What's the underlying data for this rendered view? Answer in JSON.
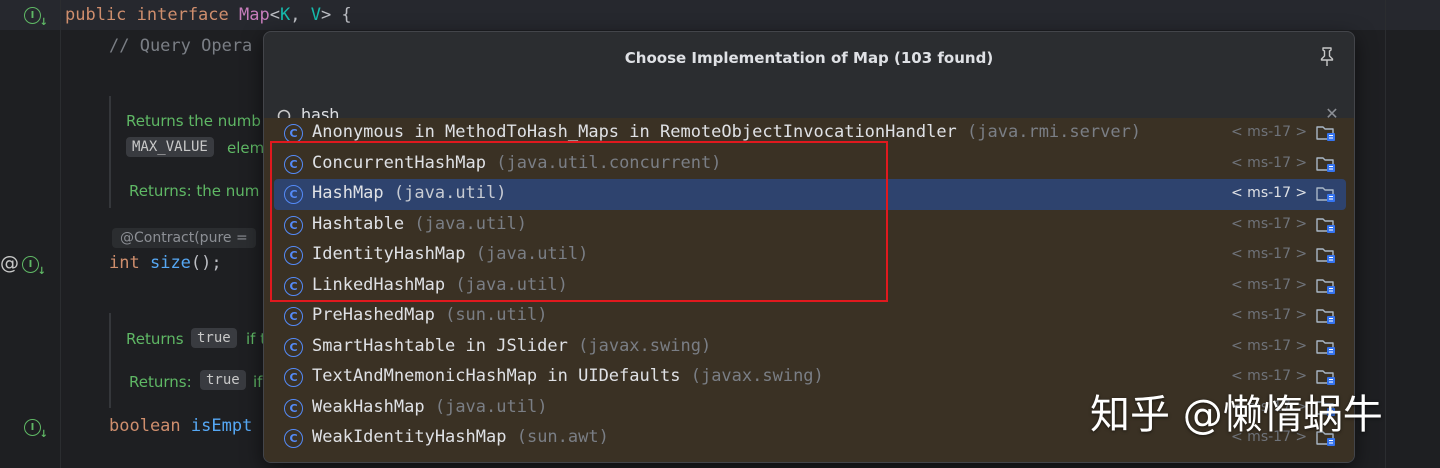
{
  "editor": {
    "line1": {
      "kw": "public interface ",
      "type": "Map",
      "lt": "<",
      "k": "K",
      "comma": ", ",
      "v": "V",
      "gt": "> {"
    },
    "comment": "// Query Opera",
    "doc1": {
      "text1": "Returns the numb",
      "code1": "MAX_VALUE",
      "text2": "elem",
      "returns": "Returns: the num"
    },
    "inlay_contract": "@Contract(pure =",
    "size_line": {
      "kw": "int",
      "fn": "size",
      "rest": "();"
    },
    "doc2": {
      "returns1": "Returns",
      "code1": "true",
      "tail1": "if t",
      "returns2": "Returns:",
      "code2": "true",
      "tail2": "if"
    },
    "isempty_line": {
      "kw": "boolean",
      "fn": "isEmpt"
    }
  },
  "popup": {
    "title": "Choose Implementation of Map (103 found)",
    "search_value": "hash",
    "items": [
      {
        "name": "Anonymous in MethodToHash_Maps in RemoteObjectInvocationHandler",
        "pkg": "(java.rmi.server)",
        "module": "< ms-17 >"
      },
      {
        "name": "ConcurrentHashMap",
        "pkg": "(java.util.concurrent)",
        "module": "< ms-17 >"
      },
      {
        "name": "HashMap",
        "pkg": "(java.util)",
        "module": "< ms-17 >"
      },
      {
        "name": "Hashtable",
        "pkg": "(java.util)",
        "module": "< ms-17 >"
      },
      {
        "name": "IdentityHashMap",
        "pkg": "(java.util)",
        "module": "< ms-17 >"
      },
      {
        "name": "LinkedHashMap",
        "pkg": "(java.util)",
        "module": "< ms-17 >"
      },
      {
        "name": "PreHashedMap",
        "pkg": "(sun.util)",
        "module": "< ms-17 >"
      },
      {
        "name": "SmartHashtable in JSlider",
        "pkg": "(javax.swing)",
        "module": "< ms-17 >"
      },
      {
        "name": "TextAndMnemonicHashMap in UIDefaults",
        "pkg": "(javax.swing)",
        "module": "< ms-17 >"
      },
      {
        "name": "WeakHashMap",
        "pkg": "(java.util)",
        "module": "< ms-17 >"
      },
      {
        "name": "WeakIdentityHashMap",
        "pkg": "(sun.awt)",
        "module": "< ms-17 >"
      }
    ],
    "selected_index": 2
  },
  "watermark": "知乎 @懒惰蜗牛",
  "colors": {
    "accent": "#548af7",
    "selection": "#2e436e",
    "list_bg": "#3a3124",
    "highlight_box": "#e0191e"
  }
}
